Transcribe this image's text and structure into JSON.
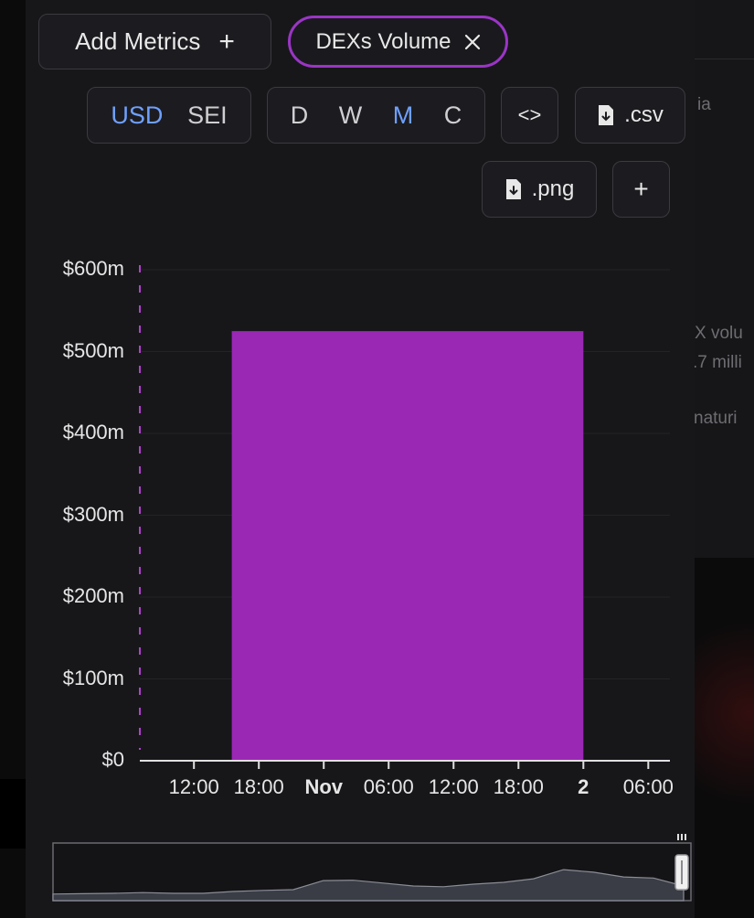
{
  "toolbar": {
    "add_metrics_label": "Add Metrics",
    "add_icon": "plus-icon",
    "metric_pill_label": "DEXs Volume",
    "metric_pill_close_icon": "close-icon",
    "currency_options": [
      "USD",
      "SEI"
    ],
    "currency_selected": "USD",
    "granularity_options": [
      "D",
      "W",
      "M",
      "C"
    ],
    "granularity_selected": "M",
    "embed_label": "<>",
    "csv_label": ".csv",
    "png_label": ".png",
    "add_chart_label": "+"
  },
  "background_text": [
    "ia",
    "X volu",
    ".7 milli",
    "naturi"
  ],
  "colors": {
    "bar": "#9b27b5",
    "accent": "#6fa0ff",
    "pill_border": "#9b35c5"
  },
  "chart_data": {
    "type": "bar",
    "title": "",
    "xlabel": "",
    "ylabel": "",
    "ylim": [
      0,
      600
    ],
    "ytick_labels": [
      "$0",
      "$100m",
      "$200m",
      "$300m",
      "$400m",
      "$500m",
      "$600m"
    ],
    "x_ticks": [
      {
        "label": "12:00",
        "hour": 12,
        "bold": false
      },
      {
        "label": "18:00",
        "hour": 18,
        "bold": false
      },
      {
        "label": "Nov",
        "hour": 24,
        "bold": true
      },
      {
        "label": "06:00",
        "hour": 30,
        "bold": false
      },
      {
        "label": "12:00",
        "hour": 36,
        "bold": false
      },
      {
        "label": "18:00",
        "hour": 42,
        "bold": false
      },
      {
        "label": "2",
        "hour": 48,
        "bold": true
      },
      {
        "label": "06:00",
        "hour": 54,
        "bold": false
      }
    ],
    "x_range_hours": [
      7,
      56
    ],
    "bars": [
      {
        "start_hour": 15.5,
        "end_hour": 48,
        "value": 525,
        "series": "DEXs Volume"
      }
    ],
    "grid": true,
    "navigator_series": [
      0.18,
      0.19,
      0.2,
      0.22,
      0.2,
      0.2,
      0.25,
      0.28,
      0.3,
      0.55,
      0.56,
      0.48,
      0.4,
      0.38,
      0.45,
      0.5,
      0.6,
      0.85,
      0.78,
      0.65,
      0.62,
      0.4
    ]
  }
}
